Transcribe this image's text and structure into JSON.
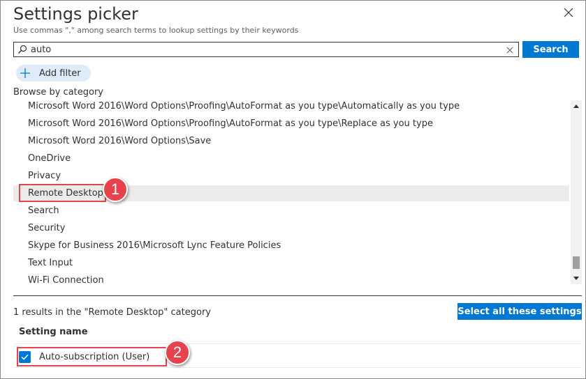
{
  "dialog": {
    "title": "Settings picker",
    "subtitle": "Use commas \",\" among search terms to lookup settings by their keywords",
    "close_icon": "close-icon"
  },
  "search": {
    "value": "auto",
    "button_label": "Search",
    "icon": "search-icon",
    "clear_icon": "clear-icon"
  },
  "filter": {
    "add_label": "Add filter",
    "icon": "plus-icon"
  },
  "browse": {
    "label": "Browse by category",
    "items": [
      {
        "label": "Microsoft Word 2016\\Word Options\\Proofing\\AutoFormat as you type\\Automatically as you type",
        "selected": false
      },
      {
        "label": "Microsoft Word 2016\\Word Options\\Proofing\\AutoFormat as you type\\Replace as you type",
        "selected": false
      },
      {
        "label": "Microsoft Word 2016\\Word Options\\Save",
        "selected": false
      },
      {
        "label": "OneDrive",
        "selected": false
      },
      {
        "label": "Privacy",
        "selected": false
      },
      {
        "label": "Remote Desktop",
        "selected": true
      },
      {
        "label": "Search",
        "selected": false
      },
      {
        "label": "Security",
        "selected": false
      },
      {
        "label": "Skype for Business 2016\\Microsoft Lync Feature Policies",
        "selected": false
      },
      {
        "label": "Text Input",
        "selected": false
      },
      {
        "label": "Wi-Fi Connection",
        "selected": false
      }
    ]
  },
  "results": {
    "count_text": "1 results in the \"Remote Desktop\" category",
    "select_all_label": "Select all these settings",
    "column_header": "Setting name",
    "rows": [
      {
        "label": "Auto-subscription (User)",
        "checked": true
      }
    ]
  },
  "callouts": {
    "first": "1",
    "second": "2"
  },
  "colors": {
    "accent": "#0078d4",
    "callout": "#e8424d",
    "selected_row": "#edebe9",
    "filter_pill": "#deecf9"
  }
}
